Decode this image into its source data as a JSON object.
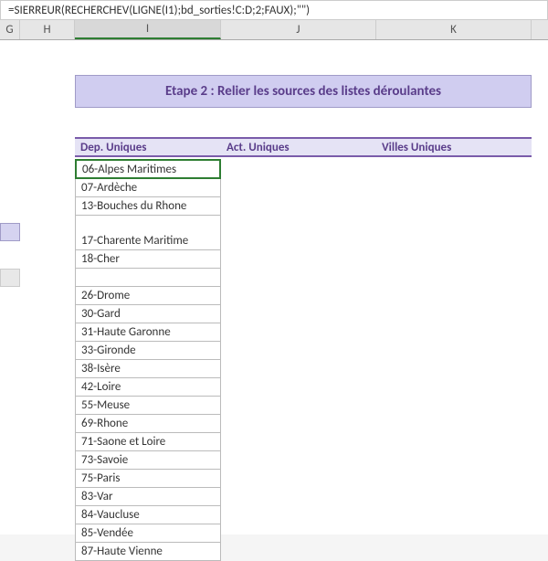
{
  "formula": "=SIERREUR(RECHERCHEV(LIGNE(I1);bd_sorties!C:D;2;FAUX);\"\")",
  "columns": {
    "g": "G",
    "h": "H",
    "i": "I",
    "j": "J",
    "k": "K"
  },
  "title": "Etape 2 : Relier les sources des listes déroulantes",
  "headers": {
    "dep": "Dep. Uniques",
    "act": "Act. Uniques",
    "villes": "Villes Uniques"
  },
  "dep_values": [
    "06-Alpes Maritimes",
    "07-Ardèche",
    "13-Bouches du Rhone",
    "17-Charente Maritime",
    "18-Cher",
    "",
    "26-Drome",
    "30-Gard",
    "31-Haute Garonne",
    "33-Gironde",
    "38-Isère",
    "42-Loire",
    "55-Meuse",
    "69-Rhone",
    "71-Saone et Loire",
    "73-Savoie",
    "75-Paris",
    "83-Var",
    "84-Vaucluse",
    "85-Vendée",
    "87-Haute Vienne"
  ]
}
